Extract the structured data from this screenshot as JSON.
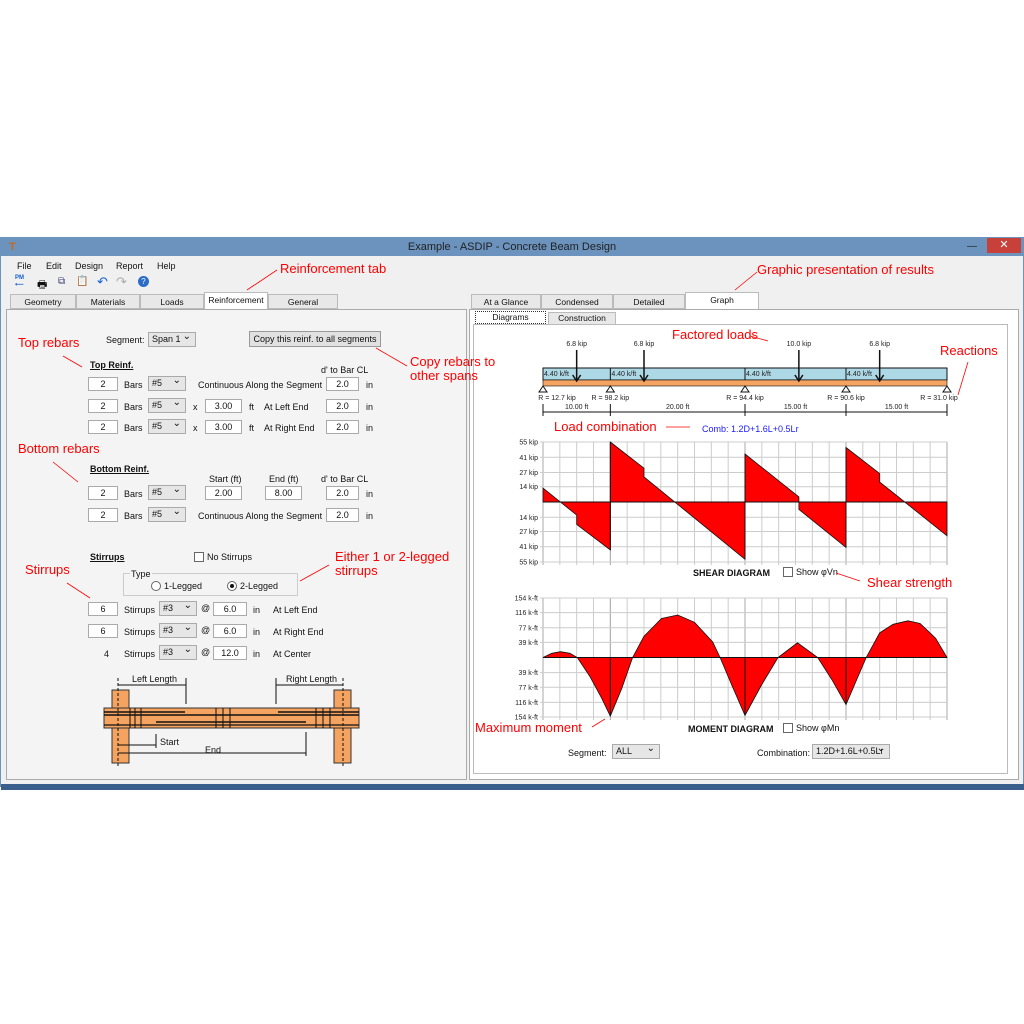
{
  "window": {
    "title": "Example - ASDIP - Concrete Beam Design",
    "close_icon": "close-icon"
  },
  "menu": [
    "File",
    "Edit",
    "Design",
    "Report",
    "Help"
  ],
  "toolbar": {
    "icons": [
      "pm-back-icon",
      "print-icon",
      "copy-icon",
      "paste-icon",
      "undo-icon",
      "redo-icon",
      "help-icon"
    ],
    "pm_label": "PM"
  },
  "left_tabs": [
    {
      "label": "Geometry"
    },
    {
      "label": "Materials"
    },
    {
      "label": "Loads"
    },
    {
      "label": "Reinforcement",
      "active": true
    },
    {
      "label": "General"
    }
  ],
  "right_tabs": [
    {
      "label": "At a Glance"
    },
    {
      "label": "Condensed"
    },
    {
      "label": "Detailed"
    },
    {
      "label": "Graph",
      "active": true
    }
  ],
  "sub_tabs": [
    {
      "label": "Diagrams",
      "active": true
    },
    {
      "label": "Construction"
    }
  ],
  "reinf": {
    "segment_label": "Segment:",
    "segment_value": "Span 1",
    "copy_button": "Copy this reinf. to all segments",
    "top_header": "Top Reinf.",
    "dprime_header": "d' to Bar CL",
    "top_rows": [
      {
        "count": "2",
        "bars": "Bars",
        "size": "#5",
        "desc": "Continuous Along the Segment",
        "d": "2.0",
        "unit": "in"
      },
      {
        "count": "2",
        "bars": "Bars",
        "size": "#5",
        "x": "x",
        "len": "3.00",
        "ft": "ft",
        "desc": "At Left End",
        "d": "2.0",
        "unit": "in"
      },
      {
        "count": "2",
        "bars": "Bars",
        "size": "#5",
        "x": "x",
        "len": "3.00",
        "ft": "ft",
        "desc": "At Right End",
        "d": "2.0",
        "unit": "in"
      }
    ],
    "bottom_header": "Bottom Reinf.",
    "start_header": "Start (ft)",
    "end_header": "End (ft)",
    "bottom_rows": [
      {
        "count": "2",
        "bars": "Bars",
        "size": "#5",
        "start": "2.00",
        "end": "8.00",
        "d": "2.0",
        "unit": "in"
      },
      {
        "count": "2",
        "bars": "Bars",
        "size": "#5",
        "desc": "Continuous Along the Segment",
        "d": "2.0",
        "unit": "in"
      }
    ],
    "stirrups_header": "Stirrups",
    "no_stirrups": "No Stirrups",
    "no_stirrups_checked": false,
    "type_label": "Type",
    "one_legged": "1-Legged",
    "two_legged": "2-Legged",
    "selected_type": "2-Legged",
    "stirrup_rows": [
      {
        "count": "6",
        "label": "Stirrups",
        "size": "#3",
        "at": "@",
        "spacing": "6.0",
        "unit": "in",
        "desc": "At Left End"
      },
      {
        "count": "6",
        "label": "Stirrups",
        "size": "#3",
        "at": "@",
        "spacing": "6.0",
        "unit": "in",
        "desc": "At Right End"
      },
      {
        "count": "4",
        "label": "Stirrups",
        "size": "#3",
        "at": "@",
        "spacing": "12.0",
        "unit": "in",
        "desc": "At Center"
      }
    ],
    "sketch": {
      "left_length": "Left Length",
      "right_length": "Right Length",
      "start": "Start",
      "end": "End"
    }
  },
  "beam": {
    "point_loads": [
      {
        "label": "6.8 kip",
        "x_ft": 5
      },
      {
        "label": "6.8 kip",
        "x_ft": 15
      },
      {
        "label": "10.0 kip",
        "x_ft": 38
      },
      {
        "label": "6.8 kip",
        "x_ft": 50
      }
    ],
    "dist_loads": [
      {
        "label": "4.40 k/ft",
        "x_ft": 0
      },
      {
        "label": "4.40 k/ft",
        "x_ft": 10
      },
      {
        "label": "4.40 k/ft",
        "x_ft": 30
      },
      {
        "label": "4.40 k/ft",
        "x_ft": 45
      }
    ],
    "supports_ft": [
      0,
      10,
      30,
      45,
      60
    ],
    "reactions": [
      "R = 12.7 kip",
      "R = 98.2 kip",
      "R = 94.4 kip",
      "R = 90.6 kip",
      "R = 31.0 kip"
    ],
    "spans": [
      "10.00 ft",
      "20.00 ft",
      "15.00 ft",
      "15.00 ft"
    ],
    "combination": "Comb: 1.2D+1.6L+0.5Lr"
  },
  "chart_data": [
    {
      "type": "area",
      "title": "SHEAR DIAGRAM",
      "xlim": [
        0,
        60
      ],
      "ylim": [
        -55,
        55
      ],
      "y_ticks": [
        "55 kip",
        "41 kip",
        "27 kip",
        "14 kip",
        "14 kip",
        "27 kip",
        "41 kip",
        "55 kip"
      ],
      "y_tick_values": [
        55,
        41,
        27,
        14,
        -14,
        -27,
        -41,
        -55
      ],
      "points": [
        [
          0,
          12.7
        ],
        [
          5,
          -12
        ],
        [
          5,
          -20.5
        ],
        [
          10,
          -44
        ],
        [
          10,
          55
        ],
        [
          15,
          31
        ],
        [
          15,
          23
        ],
        [
          30,
          -52.5
        ],
        [
          30,
          44
        ],
        [
          38,
          4.7
        ],
        [
          38,
          -6.8
        ],
        [
          45,
          -41.6
        ],
        [
          45,
          50
        ],
        [
          50,
          26
        ],
        [
          50,
          18.3
        ],
        [
          60,
          -31
        ]
      ],
      "show_label": "Show φVn",
      "show_checked": false,
      "grid": true
    },
    {
      "type": "area",
      "title": "MOMENT DIAGRAM",
      "xlim": [
        0,
        60
      ],
      "ylim": [
        -154,
        154
      ],
      "y_ticks": [
        "154 k-ft",
        "116 k-ft",
        "77 k-ft",
        "39 k-ft",
        "39 k-ft",
        "77 k-ft",
        "116 k-ft",
        "154 k-ft"
      ],
      "y_tick_values": [
        154,
        116,
        77,
        39,
        -39,
        -77,
        -116,
        -154
      ],
      "points": [
        [
          0,
          0
        ],
        [
          1.3,
          11
        ],
        [
          2.6,
          15
        ],
        [
          4,
          11
        ],
        [
          5.1,
          0
        ],
        [
          7,
          -50
        ],
        [
          8.7,
          -105
        ],
        [
          10,
          -152
        ],
        [
          11.7,
          -80
        ],
        [
          13.3,
          0
        ],
        [
          15,
          55
        ],
        [
          17.6,
          101
        ],
        [
          20,
          110
        ],
        [
          22.5,
          91
        ],
        [
          25.2,
          40
        ],
        [
          26.3,
          0
        ],
        [
          28,
          -70
        ],
        [
          30,
          -150
        ],
        [
          32.5,
          -70
        ],
        [
          34.9,
          0
        ],
        [
          37.8,
          38
        ],
        [
          40.8,
          0
        ],
        [
          43,
          -60
        ],
        [
          45,
          -122
        ],
        [
          48,
          0
        ],
        [
          50,
          64
        ],
        [
          52,
          86
        ],
        [
          54.2,
          95
        ],
        [
          56,
          88
        ],
        [
          58.3,
          50
        ],
        [
          60,
          0
        ]
      ],
      "show_label": "Show φMn",
      "show_checked": false,
      "grid": true
    }
  ],
  "controls": {
    "segment_label": "Segment:",
    "segment_value": "ALL",
    "combination_label": "Combination:",
    "combination_value": "1.2D+1.6L+0.5Lr"
  },
  "annotations": {
    "reinf_tab": "Reinforcement tab",
    "graphic": "Graphic presentation of results",
    "top_rebars": "Top rebars",
    "copy_rebars": "Copy rebars to other spans",
    "bottom_rebars": "Bottom rebars",
    "factored_loads": "Factored loads",
    "reactions": "Reactions",
    "load_combination": "Load combination",
    "stirrups": "Stirrups",
    "legged": "Either 1 or 2-legged stirrups",
    "shear_strength": "Shear strength",
    "max_moment": "Maximum moment"
  },
  "colors": {
    "annotation": "#ff0000",
    "diagram_fill": "#ff0000",
    "beam_load": "#add8e6",
    "beam": "#f4a460",
    "combination": "#1a1aff",
    "titlebar": "#6b93bd"
  }
}
